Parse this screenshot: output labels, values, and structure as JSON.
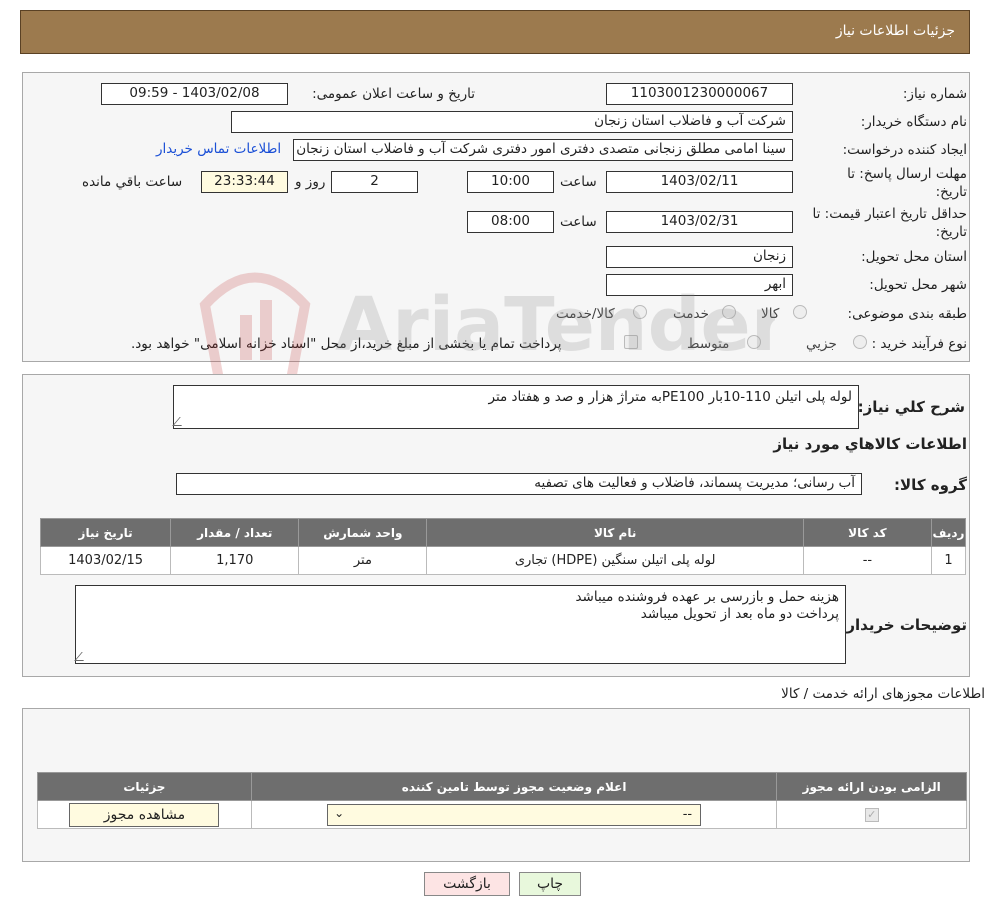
{
  "header": {
    "title": "جزئیات اطلاعات نیاز"
  },
  "form": {
    "need_number": {
      "label": "شماره نیاز:",
      "value": "1103001230000067"
    },
    "announce_datetime": {
      "label": "تاریخ و ساعت اعلان عمومی:",
      "value": "1403/02/08 - 09:59"
    },
    "buyer_org": {
      "label": "نام دستگاه خریدار:",
      "value": "شرکت آب و فاضلاب استان زنجان"
    },
    "requester": {
      "label": "ایجاد کننده درخواست:",
      "value": "سینا امامی مطلق زنجانی متصدی دفتری امور دفتری شرکت آب و فاضلاب استان زنجان",
      "contact_link": "اطلاعات تماس خریدار"
    },
    "reply_deadline": {
      "label_line1": "مهلت ارسال پاسخ: تا",
      "label_line2": "تاریخ:",
      "date": "1403/02/11",
      "time_label": "ساعت",
      "time": "10:00",
      "days": "2",
      "days_label": "روز و",
      "remaining": "23:33:44",
      "remaining_label": "ساعت باقي مانده"
    },
    "price_validity": {
      "label_line1": "حداقل تاریخ اعتبار قیمت: تا",
      "label_line2": "تاریخ:",
      "date": "1403/02/31",
      "time_label": "ساعت",
      "time": "08:00"
    },
    "delivery_province": {
      "label": "استان محل تحویل:",
      "value": "زنجان"
    },
    "delivery_city": {
      "label": "شهر محل تحویل:",
      "value": "ابهر"
    },
    "category": {
      "label": "طبقه بندی موضوعی:",
      "options": [
        "کالا",
        "خدمت",
        "کالا/خدمت"
      ]
    },
    "purchase_type": {
      "label": "نوع فرآیند خرید :",
      "options": [
        "جزیي",
        "متوسط"
      ],
      "note": "پرداخت تمام یا بخشی از مبلغ خرید،از محل \"اسناد خزانه اسلامی\" خواهد بود."
    }
  },
  "watermark": {
    "text": "AriaTender.neT"
  },
  "description": {
    "label": "شرح کلي نياز:",
    "value": "لوله پلی اتیلن 110-10بار PE100به متراژ هزار و صد و هفتاد متر"
  },
  "goods": {
    "section_title": "اطلاعات کالاهاي مورد نياز",
    "group_label": "گروه کالا:",
    "group_value": "آب رسانی؛ مدیریت پسماند، فاضلاب و فعالیت های تصفیه",
    "columns": [
      "ردیف",
      "کد کالا",
      "نام کالا",
      "واحد شمارش",
      "تعداد / مقدار",
      "تاریخ نیاز"
    ],
    "rows": [
      [
        "1",
        "--",
        "لوله پلی اتیلن سنگین (HDPE) تجاری",
        "متر",
        "1,170",
        "1403/02/15"
      ]
    ]
  },
  "buyer_notes": {
    "label": "توضیحات خریدار:",
    "lines": [
      "هزینه حمل و بازرسی بر عهده فروشنده میباشد",
      "پرداخت دو ماه بعد از تحویل میباشد"
    ]
  },
  "licenses": {
    "section_title": "اطلاعات مجوزهای ارائه خدمت / کالا",
    "columns": [
      "الزامی بودن ارائه مجوز",
      "اعلام وضعیت مجوز توسط تامین کننده",
      "جزئیات"
    ],
    "select_value": "--",
    "view_button": "مشاهده مجوز"
  },
  "buttons": {
    "print": "چاپ",
    "back": "بازگشت"
  }
}
